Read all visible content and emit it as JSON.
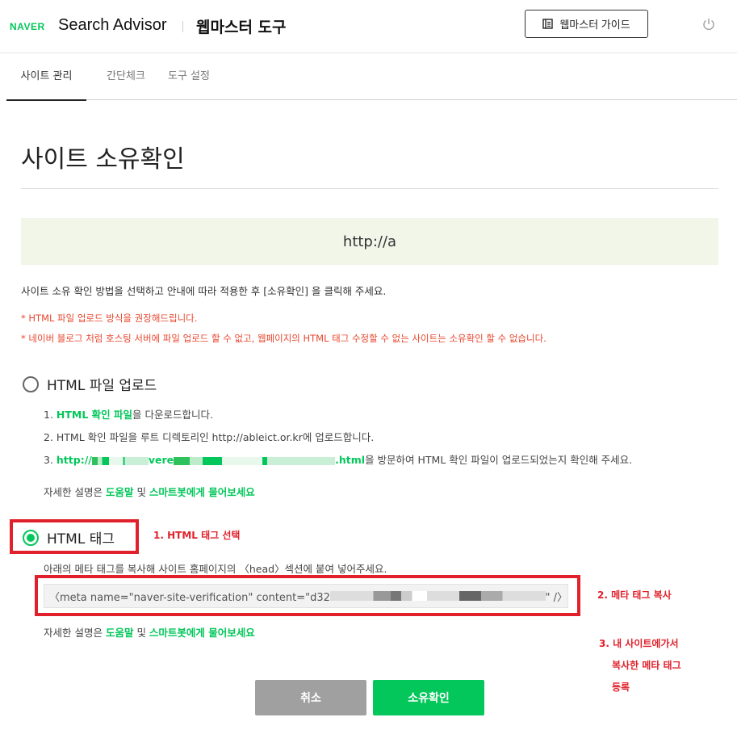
{
  "header": {
    "logo": "NAVER",
    "app_title": "Search Advisor",
    "tool_title": "웹마스터 도구",
    "guide_button": "웹마스터 가이드"
  },
  "tabs": [
    {
      "label": "사이트 관리",
      "active": true
    },
    {
      "label": "간단체크",
      "active": false
    },
    {
      "label": "도구 설정",
      "active": false
    }
  ],
  "page": {
    "title": "사이트 소유확인",
    "site_url": "http://a",
    "intro": "사이트 소유 확인 방법을 선택하고 안내에 따라 적용한 후 [소유확인] 을 클릭해 주세요.",
    "warnings": [
      "* HTML 파일 업로드 방식을 권장해드립니다.",
      "* 네이버 블로그 처럼 호스팅 서버에 파일 업로드 할 수 없고, 웹페이지의 HTML 태그 수정할 수 없는 사이트는 소유확인 할 수 없습니다."
    ]
  },
  "file_upload": {
    "label": "HTML 파일 업로드",
    "selected": false,
    "step1_prefix": "1. ",
    "step1_link": "HTML 확인 파일",
    "step1_suffix": "을 다운로드합니다.",
    "step2": "2. HTML 확인 파일을 루트 디렉토리인 http://ableict.or.kr에 업로드합니다.",
    "step3_prefix": "3. ",
    "step3_link_start": "http://",
    "step3_link_mid": "vere",
    "step3_link_end": ".html",
    "step3_suffix": "을 방문하여 HTML 확인 파일이 업로드되었는지 확인해 주세요.",
    "help_prefix": "자세한 설명은 ",
    "help_link1": "도움말",
    "help_mid": " 및 ",
    "help_link2": "스마트봇에게 물어보세요"
  },
  "html_tag": {
    "label": "HTML 태그",
    "selected": true,
    "description": "아래의 메타 태그를 복사해 사이트 홈페이지의 〈head〉섹션에 붙여 넣어주세요.",
    "meta_start": "〈meta name=\"naver-site-verification\" content=\"d32",
    "meta_end": "\" /〉",
    "help_prefix": "자세한 설명은 ",
    "help_link1": "도움말",
    "help_mid": " 및 ",
    "help_link2": "스마트봇에게 물어보세요"
  },
  "annotations": {
    "step1": "1. HTML 태그 선택",
    "step2": "2. 메타 태그 복사",
    "step3_line1": "3. 내 사이트에가서",
    "step3_line2": "복사한 메타 태그",
    "step3_line3": "등록"
  },
  "buttons": {
    "cancel": "취소",
    "confirm": "소유확인"
  },
  "colors": {
    "naver_green": "#03c75a",
    "warning_red": "#e8472f",
    "annotation_red": "#e0202a",
    "url_box_bg": "#f1f6e9"
  }
}
